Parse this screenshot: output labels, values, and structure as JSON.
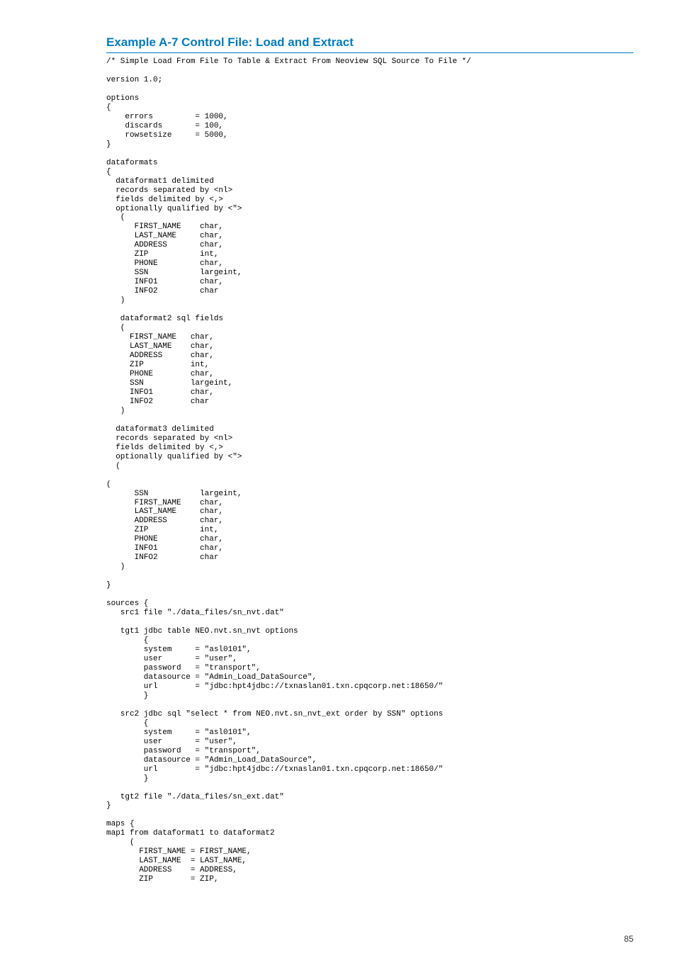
{
  "title": "Example  A-7  Control File: Load and Extract",
  "code": "/* Simple Load From File To Table & Extract From Neoview SQL Source To File */\n\nversion 1.0;\n\noptions\n{\n    errors         = 1000,\n    discards       = 100,\n    rowsetsize     = 5000,\n}\n\ndataformats\n{\n  dataformat1 delimited\n  records separated by <nl>\n  fields delimited by <,>\n  optionally qualified by <\">\n   (\n      FIRST_NAME    char,\n      LAST_NAME     char,\n      ADDRESS       char,\n      ZIP           int,\n      PHONE         char,\n      SSN           largeint,\n      INFO1         char,\n      INFO2         char\n   )\n\n   dataformat2 sql fields\n   (\n     FIRST_NAME   char,\n     LAST_NAME    char,\n     ADDRESS      char,\n     ZIP          int,\n     PHONE        char,\n     SSN          largeint,\n     INFO1        char,\n     INFO2        char\n   )\n\n  dataformat3 delimited\n  records separated by <nl>\n  fields delimited by <,>\n  optionally qualified by <\">\n  (\n\n(\n      SSN           largeint,\n      FIRST_NAME    char,\n      LAST_NAME     char,\n      ADDRESS       char,\n      ZIP           int,\n      PHONE         char,\n      INFO1         char,\n      INFO2         char\n   )\n\n}\n\nsources {\n   src1 file \"./data_files/sn_nvt.dat\"\n\n   tgt1 jdbc table NEO.nvt.sn_nvt options\n        {\n        system     = \"asl0101\",\n        user       = \"user\",\n        password   = \"transport\",\n        datasource = \"Admin_Load_DataSource\",\n        url        = \"jdbc:hpt4jdbc://txnaslan01.txn.cpqcorp.net:18650/\"\n        }\n\n   src2 jdbc sql \"select * from NEO.nvt.sn_nvt_ext order by SSN\" options\n        {\n        system     = \"asl0101\",\n        user       = \"user\",\n        password   = \"transport\",\n        datasource = \"Admin_Load_DataSource\",\n        url        = \"jdbc:hpt4jdbc://txnaslan01.txn.cpqcorp.net:18650/\"\n        }\n\n   tgt2 file \"./data_files/sn_ext.dat\"\n}\n\nmaps {\nmap1 from dataformat1 to dataformat2\n     (\n       FIRST_NAME = FIRST_NAME,\n       LAST_NAME  = LAST_NAME,\n       ADDRESS    = ADDRESS,\n       ZIP        = ZIP,",
  "page_number": "85"
}
